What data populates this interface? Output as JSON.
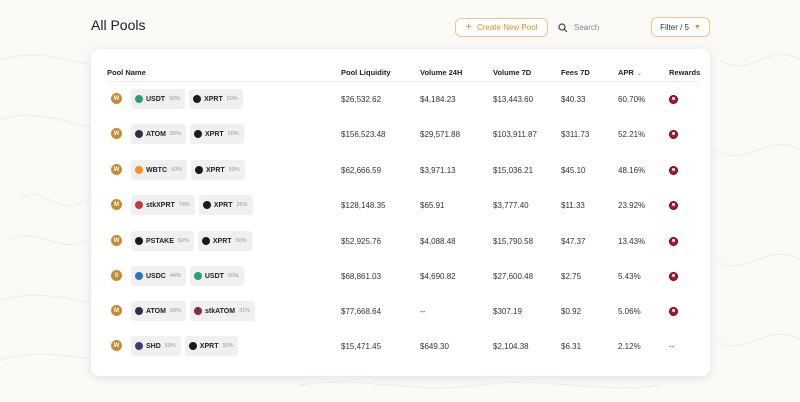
{
  "header": {
    "title": "All Pools",
    "create_label": "Create New Pool",
    "search_placeholder": "Search",
    "filter_label": "Filter / 5"
  },
  "table": {
    "columns": {
      "pool_name": "Pool Name",
      "liquidity": "Pool Liquidity",
      "volume_24h": "Volume 24H",
      "volume_7d": "Volume 7D",
      "fees_7d": "Fees 7D",
      "apr": "APR",
      "rewards": "Rewards"
    },
    "rows": [
      {
        "pool_icon": "W",
        "tokens": [
          {
            "name": "USDT",
            "weight": "50%",
            "icon": "usdt-icon",
            "color": "#26a17b"
          },
          {
            "name": "XPRT",
            "weight": "50%",
            "icon": "xprt-icon",
            "color": "#1a1a1a"
          }
        ],
        "liquidity": "$26,532.62",
        "volume_24h": "$4,184.23",
        "volume_7d": "$13,443.60",
        "fees_7d": "$40.33",
        "apr": "60.70%",
        "rewards": "reward-token-icon"
      },
      {
        "pool_icon": "W",
        "tokens": [
          {
            "name": "ATOM",
            "weight": "50%",
            "icon": "atom-icon",
            "color": "#2e3148"
          },
          {
            "name": "XPRT",
            "weight": "50%",
            "icon": "xprt-icon",
            "color": "#1a1a1a"
          }
        ],
        "liquidity": "$156,523.48",
        "volume_24h": "$29,571.88",
        "volume_7d": "$103,911.87",
        "fees_7d": "$311.73",
        "apr": "52.21%",
        "rewards": "reward-token-icon"
      },
      {
        "pool_icon": "W",
        "tokens": [
          {
            "name": "WBTC",
            "weight": "50%",
            "icon": "wbtc-icon",
            "color": "#f7931a"
          },
          {
            "name": "XPRT",
            "weight": "50%",
            "icon": "xprt-icon",
            "color": "#1a1a1a"
          }
        ],
        "liquidity": "$62,666.59",
        "volume_24h": "$3,971.13",
        "volume_7d": "$15,036.21",
        "fees_7d": "$45.10",
        "apr": "48.16%",
        "rewards": "reward-token-icon"
      },
      {
        "pool_icon": "M",
        "tokens": [
          {
            "name": "stkXPRT",
            "weight": "74%",
            "icon": "stkxprt-icon",
            "color": "#c43a3a"
          },
          {
            "name": "XPRT",
            "weight": "26%",
            "icon": "xprt-icon",
            "color": "#1a1a1a"
          }
        ],
        "liquidity": "$128,148.35",
        "volume_24h": "$65.91",
        "volume_7d": "$3,777.40",
        "fees_7d": "$11.33",
        "apr": "23.92%",
        "rewards": "reward-token-icon"
      },
      {
        "pool_icon": "W",
        "tokens": [
          {
            "name": "PSTAKE",
            "weight": "50%",
            "icon": "pstake-icon",
            "color": "#1a1a1a"
          },
          {
            "name": "XPRT",
            "weight": "50%",
            "icon": "xprt-icon",
            "color": "#1a1a1a"
          }
        ],
        "liquidity": "$52,925.76",
        "volume_24h": "$4,088.48",
        "volume_7d": "$15,790.58",
        "fees_7d": "$47.37",
        "apr": "13.43%",
        "rewards": "reward-token-icon"
      },
      {
        "pool_icon": "S",
        "tokens": [
          {
            "name": "USDC",
            "weight": "44%",
            "icon": "usdc-icon",
            "color": "#2775ca"
          },
          {
            "name": "USDT",
            "weight": "56%",
            "icon": "usdt-icon",
            "color": "#26a17b"
          }
        ],
        "liquidity": "$68,861.03",
        "volume_24h": "$4,690.82",
        "volume_7d": "$27,600.48",
        "fees_7d": "$2.75",
        "apr": "5.43%",
        "rewards": "reward-token-icon"
      },
      {
        "pool_icon": "M",
        "tokens": [
          {
            "name": "ATOM",
            "weight": "69%",
            "icon": "atom-icon",
            "color": "#2e3148"
          },
          {
            "name": "stkATOM",
            "weight": "31%",
            "icon": "stkatom-icon",
            "color": "#8a2a3a"
          }
        ],
        "liquidity": "$77,668.64",
        "volume_24h": "--",
        "volume_7d": "$307.19",
        "fees_7d": "$0.92",
        "apr": "5.06%",
        "rewards": "reward-token-icon"
      },
      {
        "pool_icon": "W",
        "tokens": [
          {
            "name": "SHD",
            "weight": "50%",
            "icon": "shd-icon",
            "color": "#3a3f6b"
          },
          {
            "name": "XPRT",
            "weight": "50%",
            "icon": "xprt-icon",
            "color": "#1a1a1a"
          }
        ],
        "liquidity": "$15,471.45",
        "volume_24h": "$649.30",
        "volume_7d": "$2,104.38",
        "fees_7d": "$6.31",
        "apr": "2.12%",
        "rewards": "--"
      }
    ]
  },
  "colors": {
    "accent": "#e08c26",
    "pool_badge": "#c98a30",
    "reward": "#c0102b"
  }
}
